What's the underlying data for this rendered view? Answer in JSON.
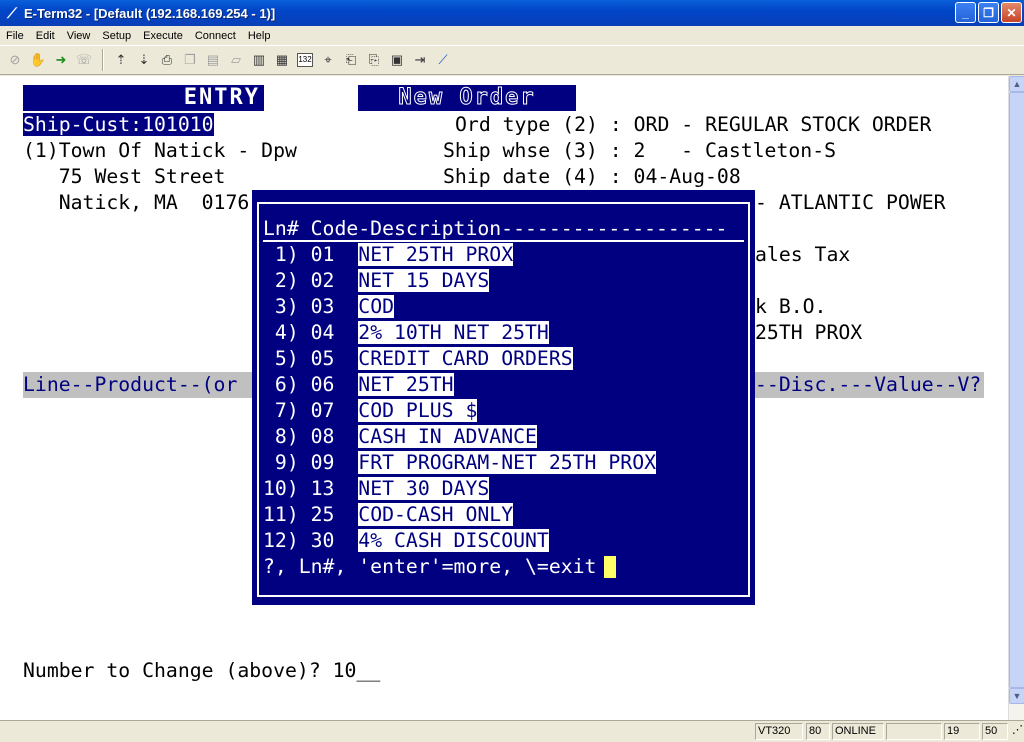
{
  "window": {
    "title": "E-Term32 - [Default (192.168.169.254 - 1)]",
    "minimize": "_",
    "restore": "❐",
    "close": "✕"
  },
  "menu": [
    "File",
    "Edit",
    "View",
    "Setup",
    "Execute",
    "Connect",
    "Help"
  ],
  "terminal": {
    "entry_title": "ENTRY",
    "new_order_title": "New Order",
    "ship_cust_label": "Ship-Cust:",
    "ship_cust_value": "101010",
    "ord_type": "Ord type (2) : ORD - REGULAR STOCK ORDER",
    "cust_name": "(1)Town Of Natick - Dpw",
    "ship_whse": "Ship whse (3) : 2   - Castleton-S",
    "address1": "   75 West Street",
    "ship_date": "Ship date (4) : 04-Aug-08",
    "address2": "   Natick, MA  0176",
    "carrier_partial": "- ATLANTIC POWER",
    "tax_partial": "ales Tax",
    "bo_partial": "k B.O.",
    "terms_partial": "25TH PROX",
    "line_header_left": "Line--Product--(or ",
    "line_header_right": "--Disc.---Value--V?",
    "number_to_change": "Number to Change (above)? 10__"
  },
  "popup": {
    "header": "Ln# Code-Description-------------------",
    "rows": [
      {
        "num": " 1) 01  ",
        "desc": "NET 25TH PROX"
      },
      {
        "num": " 2) 02  ",
        "desc": "NET 15 DAYS"
      },
      {
        "num": " 3) 03  ",
        "desc": "COD"
      },
      {
        "num": " 4) 04  ",
        "desc": "2% 10TH NET 25TH"
      },
      {
        "num": " 5) 05  ",
        "desc": "CREDIT CARD ORDERS"
      },
      {
        "num": " 6) 06  ",
        "desc": "NET 25TH"
      },
      {
        "num": " 7) 07  ",
        "desc": "COD PLUS $"
      },
      {
        "num": " 8) 08  ",
        "desc": "CASH IN ADVANCE"
      },
      {
        "num": " 9) 09  ",
        "desc": "FRT PROGRAM-NET 25TH PROX"
      },
      {
        "num": "10) 13  ",
        "desc": "NET 30 DAYS"
      },
      {
        "num": "11) 25  ",
        "desc": "COD-CASH ONLY"
      },
      {
        "num": "12) 30  ",
        "desc": "4% CASH DISCOUNT"
      }
    ],
    "prompt": "?, Ln#, 'enter'=more, \\=exit"
  },
  "status": {
    "terminal_type": "VT320",
    "columns": "80",
    "state": "ONLINE",
    "row": "19",
    "col": "50"
  },
  "colors": {
    "terminal_reverse_bg": "#000080",
    "terminal_bg": "#ffffff",
    "cursor": "#ffff66"
  }
}
